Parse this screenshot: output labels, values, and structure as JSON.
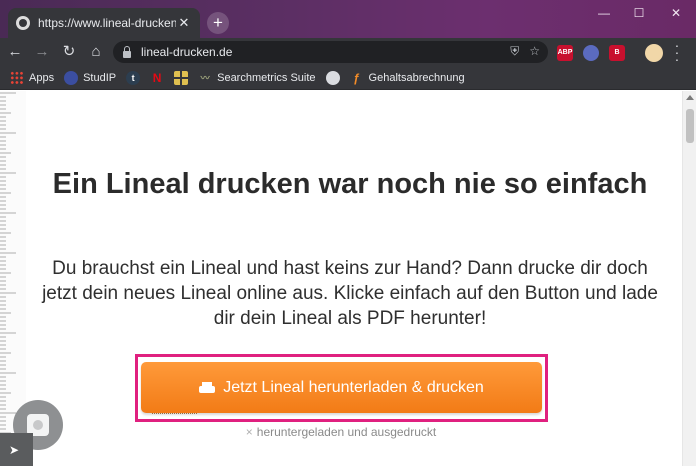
{
  "browser": {
    "tab_title": "https://www.lineal-drucken.de",
    "tab_close": "✕",
    "new_tab": "+",
    "window_controls": {
      "minimize": "—",
      "maximize": "☐",
      "close": "✕"
    },
    "nav": {
      "back": "←",
      "forward": "→",
      "reload": "↻",
      "home": "⌂"
    },
    "url": "lineal-drucken.de",
    "omnibox_icons": [
      "shield-icon",
      "star-icon"
    ],
    "extensions": [
      {
        "name": "abp-icon",
        "label": "ABP",
        "color": "#c8102e"
      },
      {
        "name": "extension-icon",
        "label": "",
        "color": "#5b6bc0"
      },
      {
        "name": "bitwarden-icon",
        "label": "B",
        "color": "#c8102e"
      }
    ]
  },
  "bookmarks": [
    {
      "label": "Apps",
      "icon": "apps-grid-icon",
      "color": "#4285f4"
    },
    {
      "label": "StudIP",
      "icon": "studip-icon",
      "color": "#3b4ea0"
    },
    {
      "label": "",
      "icon": "tumblr-icon",
      "color": "#2c3e50",
      "glyph": "t"
    },
    {
      "label": "",
      "icon": "netflix-icon",
      "color": "#e50914",
      "glyph": "N"
    },
    {
      "label": "",
      "icon": "grid-icon",
      "color": "#e0c050"
    },
    {
      "label": "Searchmetrics Suite",
      "icon": "searchmetrics-icon",
      "color": "#7a8a5a"
    },
    {
      "label": "",
      "icon": "globe-icon",
      "color": "#dadce0"
    },
    {
      "label": "Gehaltsabrechnung",
      "icon": "payroll-icon",
      "color": "#f28c28"
    }
  ],
  "page": {
    "headline": "Ein Lineal drucken war noch nie so einfach",
    "intro": "Du brauchst ein Lineal und hast keins zur Hand? Dann drucke dir doch jetzt dein neues Lineal online aus. Klicke einfach auf den Button und lade dir dein Lineal als PDF herunter!",
    "cta_label": "Jetzt Lineal herunterladen & drucken",
    "download_note_prefix": "×",
    "download_note": "heruntergeladen und ausgedruckt"
  },
  "colors": {
    "accent_highlight": "#e0207f",
    "cta_orange": "#f58220"
  }
}
